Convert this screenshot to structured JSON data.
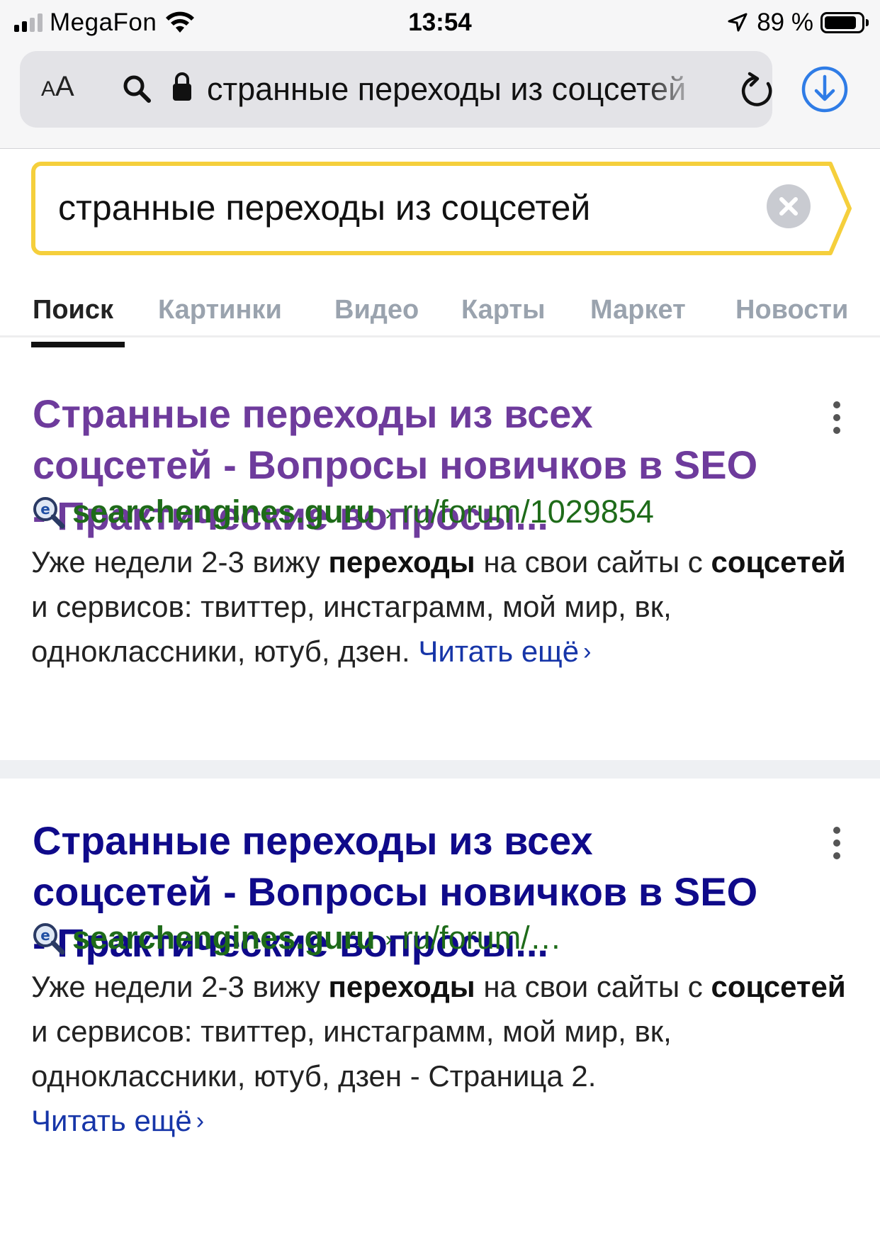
{
  "status_bar": {
    "carrier": "MegaFon",
    "time": "13:54",
    "battery": "89 %"
  },
  "browser": {
    "text_size_label_small": "A",
    "text_size_label_large": "A",
    "address_text": "странные переходы из соцсетей"
  },
  "search": {
    "query": "странные переходы из соцсетей",
    "accent_color": "#f5cf3c"
  },
  "tabs": [
    {
      "label": "Поиск",
      "active": true
    },
    {
      "label": "Картинки",
      "active": false
    },
    {
      "label": "Видео",
      "active": false
    },
    {
      "label": "Карты",
      "active": false
    },
    {
      "label": "Маркет",
      "active": false
    },
    {
      "label": "Новости",
      "active": false
    }
  ],
  "results": [
    {
      "title": "Странные переходы из всех соцсетей - Вопросы новичков в SEO - Практические вопросы...",
      "domain": "searchengines.guru",
      "path_separator": "›",
      "path": "ru/forum/1029854",
      "snippet": {
        "part1": "Уже недели 2-3 вижу ",
        "bold1": "переходы",
        "part2": " на свои сайты с ",
        "bold2": "соцсетей",
        "part3": " и сервисов: твиттер, инстаграмм, мой мир, вк, одноклассники, ютуб, дзен. "
      },
      "read_more": "Читать ещё",
      "read_more_chevron": "›",
      "visited": true
    },
    {
      "title": "Странные переходы из всех соцсетей - Вопросы новичков в SEO - Практические вопросы...",
      "domain": "searchengines.guru",
      "path_separator": "›",
      "path": "ru/forum/…",
      "snippet": {
        "part1": "Уже недели 2-3 вижу ",
        "bold1": "переходы",
        "part2": " на свои сайты с ",
        "bold2": "соцсетей",
        "part3": " и сервисов: твиттер, инстаграмм, мой мир, вк, одноклассники, ютуб, дзен - Страница 2."
      },
      "read_more": "Читать ещё",
      "read_more_chevron": "›",
      "visited": false
    }
  ],
  "colors": {
    "visited_title": "#6e3b9c",
    "unvisited_title": "#0f0a8a",
    "url_green": "#1e6b19",
    "link_blue": "#1635a8",
    "ios_blue": "#2f7ce6"
  }
}
